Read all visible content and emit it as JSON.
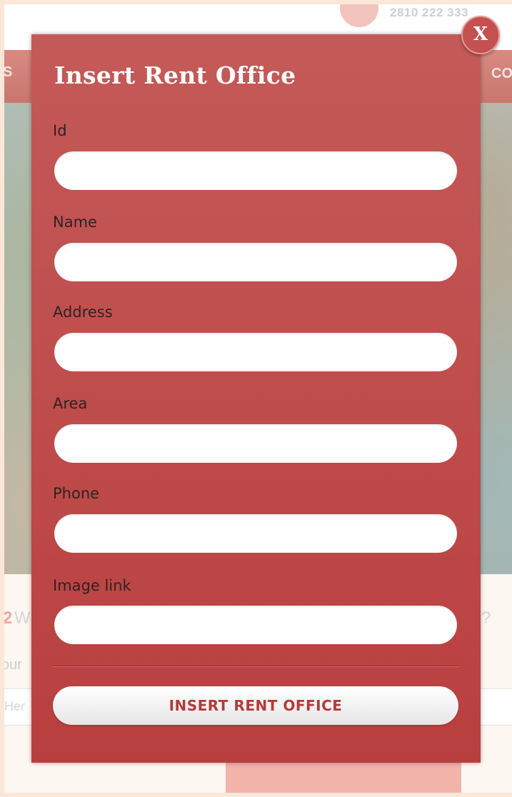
{
  "background": {
    "phone_number": "2810 222 333",
    "nav_left_fragment": "S",
    "nav_right_fragment": "CO",
    "step_number": "2",
    "step_letter": "W",
    "step_question_mark": "?",
    "partial_label": "our",
    "partial_input": "Her"
  },
  "modal": {
    "title": "Insert Rent Office",
    "close_label": "X",
    "fields": [
      {
        "label": "Id",
        "value": "",
        "placeholder": ""
      },
      {
        "label": "Name",
        "value": "",
        "placeholder": ""
      },
      {
        "label": "Address",
        "value": "",
        "placeholder": ""
      },
      {
        "label": "Area",
        "value": "",
        "placeholder": ""
      },
      {
        "label": "Phone",
        "value": "",
        "placeholder": ""
      },
      {
        "label": "Image link",
        "value": "",
        "placeholder": ""
      }
    ],
    "submit_label": "INSERT RENT OFFICE"
  },
  "colors": {
    "modal_background": "#bd4a49",
    "title_text": "#ffffff",
    "label_text": "#2e2222",
    "button_text": "#b53a3a",
    "page_background": "#fbe7d8"
  },
  "icons": {
    "close": "close-icon",
    "phone": "phone-icon"
  }
}
